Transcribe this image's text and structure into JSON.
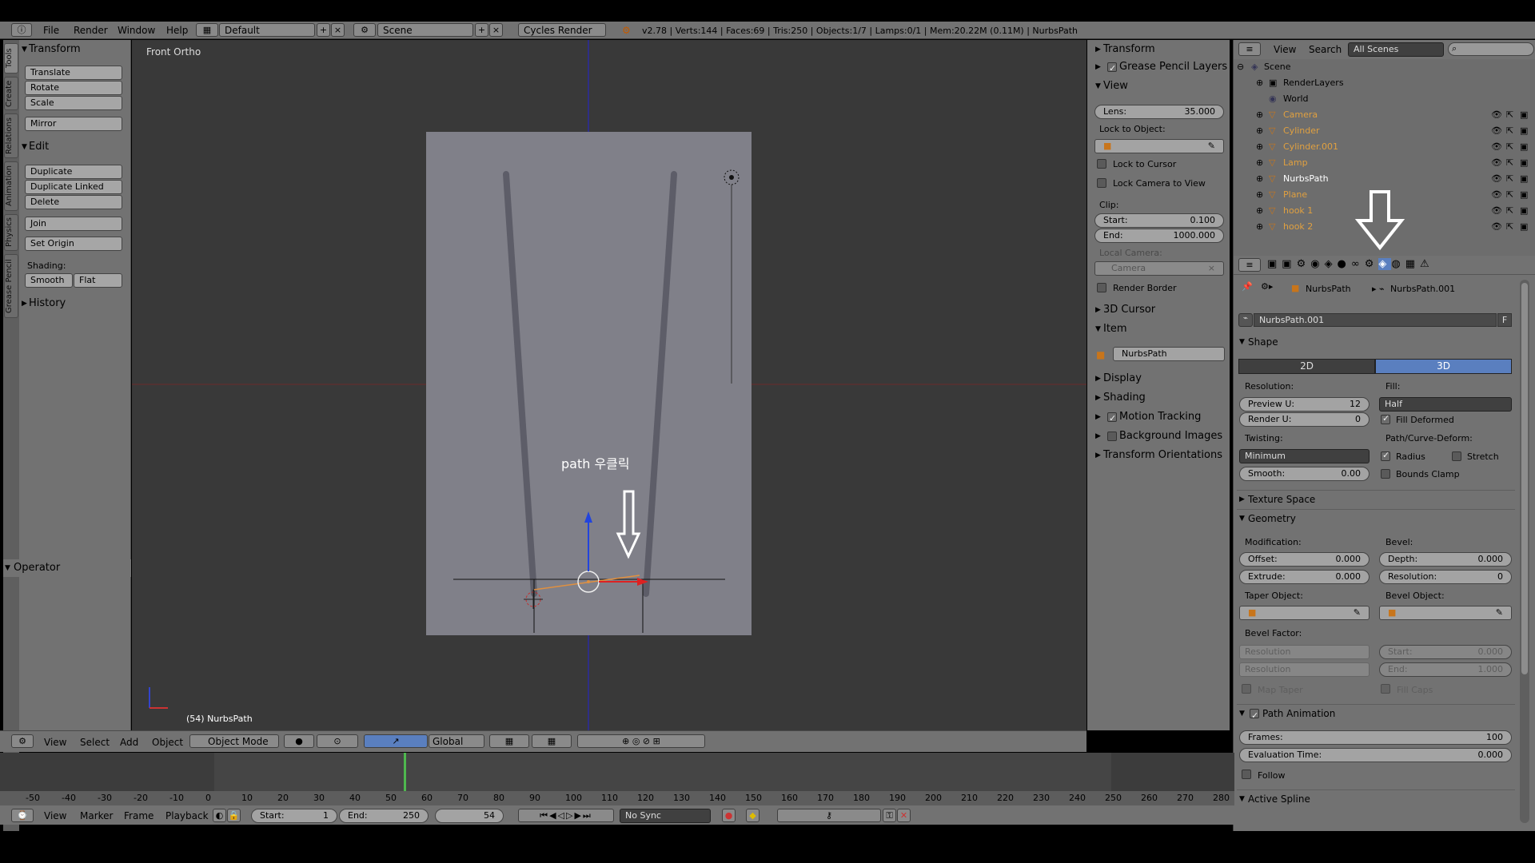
{
  "infobar": {
    "menus": [
      "File",
      "Render",
      "Window",
      "Help"
    ],
    "layout": "Default",
    "scene": "Scene",
    "engine": "Cycles Render",
    "stats": "v2.78 | Verts:144 | Faces:69 | Tris:250 | Objects:1/7 | Lamps:0/1 | Mem:20.22M (0.11M) | NurbsPath"
  },
  "tabs": [
    "Tools",
    "Create",
    "Relations",
    "Animation",
    "Physics",
    "Grease Pencil"
  ],
  "toolshelf": {
    "transform_title": "Transform",
    "translate": "Translate",
    "rotate": "Rotate",
    "scale": "Scale",
    "mirror": "Mirror",
    "edit_title": "Edit",
    "duplicate": "Duplicate",
    "duplicate_linked": "Duplicate Linked",
    "delete": "Delete",
    "join": "Join",
    "set_origin": "Set Origin",
    "shading_label": "Shading:",
    "smooth": "Smooth",
    "flat": "Flat",
    "history_title": "History",
    "operator_title": "Operator"
  },
  "viewport": {
    "view_name": "Front Ortho",
    "annotation": "path 우클릭",
    "frame_object": "(54) NurbsPath"
  },
  "vpheader": {
    "items": [
      "View",
      "Select",
      "Add",
      "Object"
    ],
    "mode": "Object Mode",
    "orientation": "Global"
  },
  "npanel": {
    "transform": "Transform",
    "grease_pencil": "Grease Pencil Layers",
    "view": "View",
    "lens_label": "Lens:",
    "lens_value": "35.000",
    "lock_to_object": "Lock to Object:",
    "lock_cursor": "Lock to Cursor",
    "lock_camera": "Lock Camera to View",
    "clip": "Clip:",
    "start_label": "Start:",
    "start_value": "0.100",
    "end_label": "End:",
    "end_value": "1000.000",
    "local_camera": "Local Camera:",
    "camera": "Camera",
    "render_border": "Render Border",
    "cursor3d": "3D Cursor",
    "item": "Item",
    "item_name": "NurbsPath",
    "display": "Display",
    "shading": "Shading",
    "motion_tracking": "Motion Tracking",
    "background_images": "Background Images",
    "transform_orientations": "Transform Orientations"
  },
  "outliner": {
    "view": "View",
    "search": "Search",
    "filter": "All Scenes",
    "scene": "Scene",
    "renderlayers": "RenderLayers",
    "world": "World",
    "objects": [
      {
        "name": "Camera",
        "color": "#e0a040"
      },
      {
        "name": "Cylinder",
        "color": "#e0a040"
      },
      {
        "name": "Cylinder.001",
        "color": "#e0a040"
      },
      {
        "name": "Lamp",
        "color": "#e0a040"
      },
      {
        "name": "NurbsPath",
        "color": "#ffffff"
      },
      {
        "name": "Plane",
        "color": "#e0a040"
      },
      {
        "name": "hook 1",
        "color": "#e0a040"
      },
      {
        "name": "hook 2",
        "color": "#e0a040"
      }
    ]
  },
  "props": {
    "object": "NurbsPath",
    "data": "NurbsPath.001",
    "datablock": "NurbsPath.001",
    "fake": "F",
    "shape": "Shape",
    "d2": "2D",
    "d3": "3D",
    "resolution": "Resolution:",
    "preview_u_label": "Preview U:",
    "preview_u": "12",
    "render_u_label": "Render U:",
    "render_u": "0",
    "fill": "Fill:",
    "fill_value": "Half",
    "fill_deformed": "Fill Deformed",
    "twisting": "Twisting:",
    "twisting_value": "Minimum",
    "path_curve_deform": "Path/Curve-Deform:",
    "radius": "Radius",
    "stretch": "Stretch",
    "bounds_clamp": "Bounds Clamp",
    "smooth_label": "Smooth:",
    "smooth_value": "0.00",
    "texture_space": "Texture Space",
    "geometry": "Geometry",
    "modification": "Modification:",
    "bevel": "Bevel:",
    "offset_label": "Offset:",
    "offset_value": "0.000",
    "depth_label": "Depth:",
    "depth_value": "0.000",
    "extrude_label": "Extrude:",
    "extrude_value": "0.000",
    "bres_label": "Resolution:",
    "bres_value": "0",
    "taper_object": "Taper Object:",
    "bevel_object": "Bevel Object:",
    "bevel_factor": "Bevel Factor:",
    "bf_res1": "Resolution",
    "bf_res2": "Resolution",
    "bf_start_label": "Start:",
    "bf_start": "0.000",
    "bf_end_label": "End:",
    "bf_end": "1.000",
    "map_taper": "Map Taper",
    "fill_caps": "Fill Caps",
    "path_animation": "Path Animation",
    "frames_label": "Frames:",
    "frames_value": "100",
    "eval_label": "Evaluation Time:",
    "eval_value": "0.000",
    "follow": "Follow",
    "active_spline": "Active Spline"
  },
  "timeline": {
    "ticks": [
      "-50",
      "-40",
      "-30",
      "-20",
      "-10",
      "0",
      "10",
      "20",
      "30",
      "40",
      "50",
      "60",
      "70",
      "80",
      "90",
      "100",
      "110",
      "120",
      "130",
      "140",
      "150",
      "160",
      "170",
      "180",
      "190",
      "200",
      "210",
      "220",
      "230",
      "240",
      "250",
      "260",
      "270",
      "280"
    ],
    "current_frame": 54
  },
  "tlheader": {
    "items": [
      "View",
      "Marker",
      "Frame",
      "Playback"
    ],
    "start_label": "Start:",
    "start": "1",
    "end_label": "End:",
    "end": "250",
    "frame": "54",
    "sync": "No Sync"
  }
}
